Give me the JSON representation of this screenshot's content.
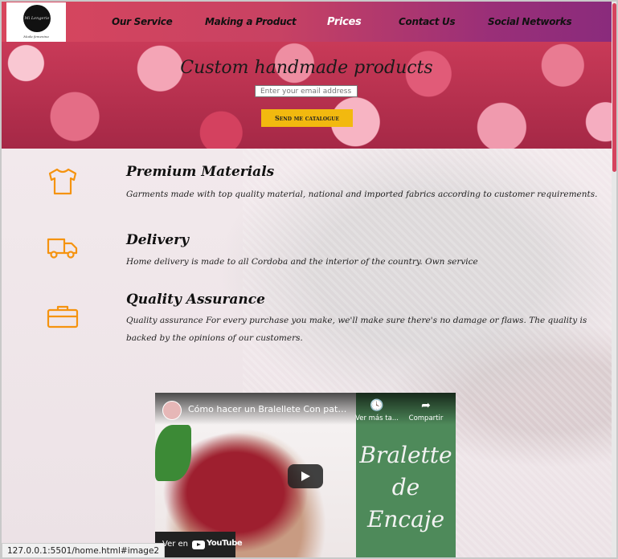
{
  "brand": {
    "logo_text": "Mi Lengerie",
    "logo_subtitle": "Moda femenina"
  },
  "nav": {
    "items": [
      {
        "label": "Our Service"
      },
      {
        "label": "Making a Product"
      },
      {
        "label": "Prices"
      },
      {
        "label": "Contact Us"
      },
      {
        "label": "Social Networks"
      }
    ],
    "active_color": "#ffffff"
  },
  "hero": {
    "title": "Custom handmade products",
    "email_placeholder": "Enter your email address",
    "button_label": "Send me catalogue",
    "button_color": "#f2b90f"
  },
  "features": [
    {
      "icon": "tshirt-icon",
      "title": "Premium Materials",
      "text": "Garments made with top quality material, national and imported fabrics according to customer requirements."
    },
    {
      "icon": "truck-icon",
      "title": "Delivery",
      "text": "Home delivery is made to all Cordoba and the interior of the country. Own service"
    },
    {
      "icon": "briefcase-icon",
      "title": "Quality Assurance",
      "text": "Quality assurance For every purchase you make, we'll make sure there's no damage or flaws. The quality is backed by the opinions of our customers."
    }
  ],
  "accent_color": "#f5930f",
  "video": {
    "title": "Cómo hacer un Bralellete Con patro...",
    "watch_later": "Ver más ta...",
    "share": "Compartir",
    "overlay_lines": [
      "Bralette",
      "de",
      "Encaje"
    ],
    "watch_on": "Ver en",
    "youtube": "YouTube"
  },
  "status_bar": {
    "url": "127.0.0.1:5501/home.html#image2"
  }
}
